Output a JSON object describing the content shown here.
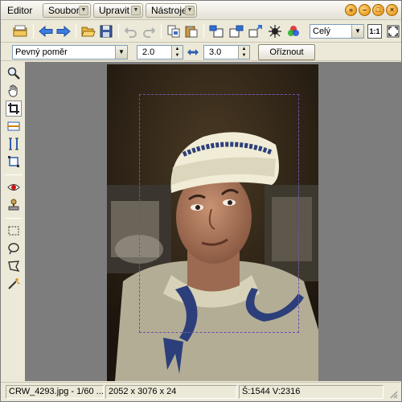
{
  "titlebar": {
    "app_title": "Editor",
    "menus": [
      {
        "label": "Soubor"
      },
      {
        "label": "Upravit"
      },
      {
        "label": "Nástroje"
      }
    ]
  },
  "toolbar": {
    "zoom_value": "Celý",
    "actual_size_label": "1:1"
  },
  "crop": {
    "ratio_mode": "Pevný poměr",
    "width_ratio": "2.0",
    "height_ratio": "3.0",
    "crop_button_label": "Oříznout"
  },
  "statusbar": {
    "file_info": "CRW_4293.jpg - 1/60 ...",
    "dimensions": "2052 x 3076 x 24",
    "selection_size": "Š:1544  V:2316"
  },
  "colors": {
    "accent_orange": "#f0a000",
    "crop_outline": "#6b4ea8",
    "canvas_bg": "#7d7d7d"
  }
}
